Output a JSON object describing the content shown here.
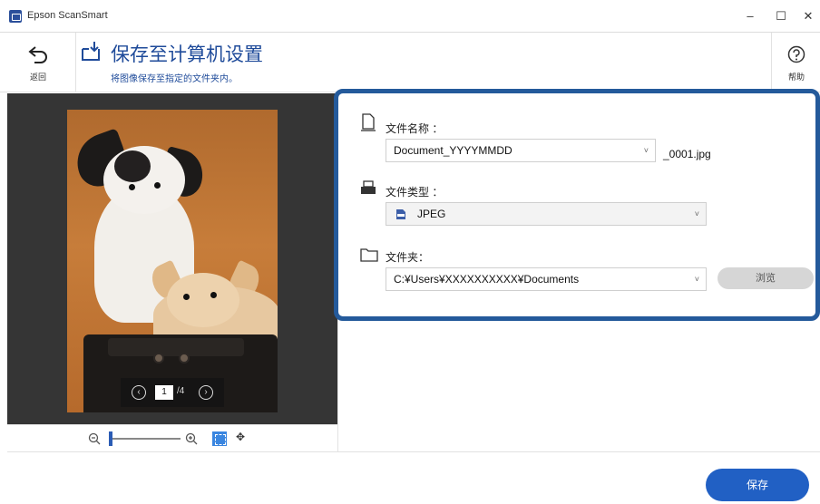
{
  "window": {
    "title": "Epson ScanSmart",
    "minimize": "–",
    "maximize": "☐",
    "close": "✕"
  },
  "header": {
    "back_label": "返回",
    "title": "保存至计算机设置",
    "subtitle": "将图像保存至指定的文件夹内。",
    "help_label": "帮助"
  },
  "preview": {
    "pager": {
      "current_page": "1",
      "total": "/4",
      "prev": "‹",
      "next": "›"
    },
    "zoom_level": 0.0
  },
  "settings": {
    "filename": {
      "label": "文件名称 ：",
      "value": "Document_YYYYMMDD",
      "suffix": "_0001.jpg"
    },
    "filetype": {
      "label": "文件类型 ：",
      "value": "JPEG"
    },
    "folder": {
      "label": "文件夹：",
      "value": "C:¥Users¥XXXXXXXXXX¥Documents",
      "browse_label": "浏览"
    }
  },
  "footer": {
    "save_label": "保存"
  },
  "colors": {
    "accent": "#2160c4",
    "panel_border": "#245a9b",
    "title_blue": "#1f4b9a"
  }
}
